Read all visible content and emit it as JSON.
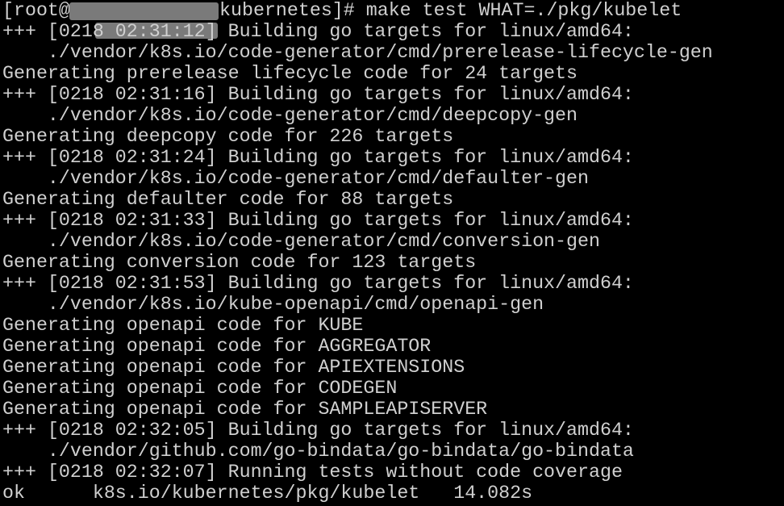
{
  "terminal": {
    "colors": {
      "background": "#000000",
      "foreground": "#d0d0d0",
      "redaction": "#7a7a7a"
    },
    "prompt": {
      "prefix": "[root@",
      "suffix": "kubernetes]# make test WHAT=./pkg/kubelet"
    },
    "output": [
      "+++ [0218 02:31:12] Building go targets for linux/amd64:",
      "    ./vendor/k8s.io/code-generator/cmd/prerelease-lifecycle-gen",
      "Generating prerelease lifecycle code for 24 targets",
      "+++ [0218 02:31:16] Building go targets for linux/amd64:",
      "    ./vendor/k8s.io/code-generator/cmd/deepcopy-gen",
      "Generating deepcopy code for 226 targets",
      "+++ [0218 02:31:24] Building go targets for linux/amd64:",
      "    ./vendor/k8s.io/code-generator/cmd/defaulter-gen",
      "Generating defaulter code for 88 targets",
      "+++ [0218 02:31:33] Building go targets for linux/amd64:",
      "    ./vendor/k8s.io/code-generator/cmd/conversion-gen",
      "Generating conversion code for 123 targets",
      "+++ [0218 02:31:53] Building go targets for linux/amd64:",
      "    ./vendor/k8s.io/kube-openapi/cmd/openapi-gen",
      "Generating openapi code for KUBE",
      "Generating openapi code for AGGREGATOR",
      "Generating openapi code for APIEXTENSIONS",
      "Generating openapi code for CODEGEN",
      "Generating openapi code for SAMPLEAPISERVER",
      "+++ [0218 02:32:05] Building go targets for linux/amd64:",
      "    ./vendor/github.com/go-bindata/go-bindata/go-bindata",
      "+++ [0218 02:32:07] Running tests without code coverage",
      "ok      k8s.io/kubernetes/pkg/kubelet   14.082s"
    ]
  }
}
